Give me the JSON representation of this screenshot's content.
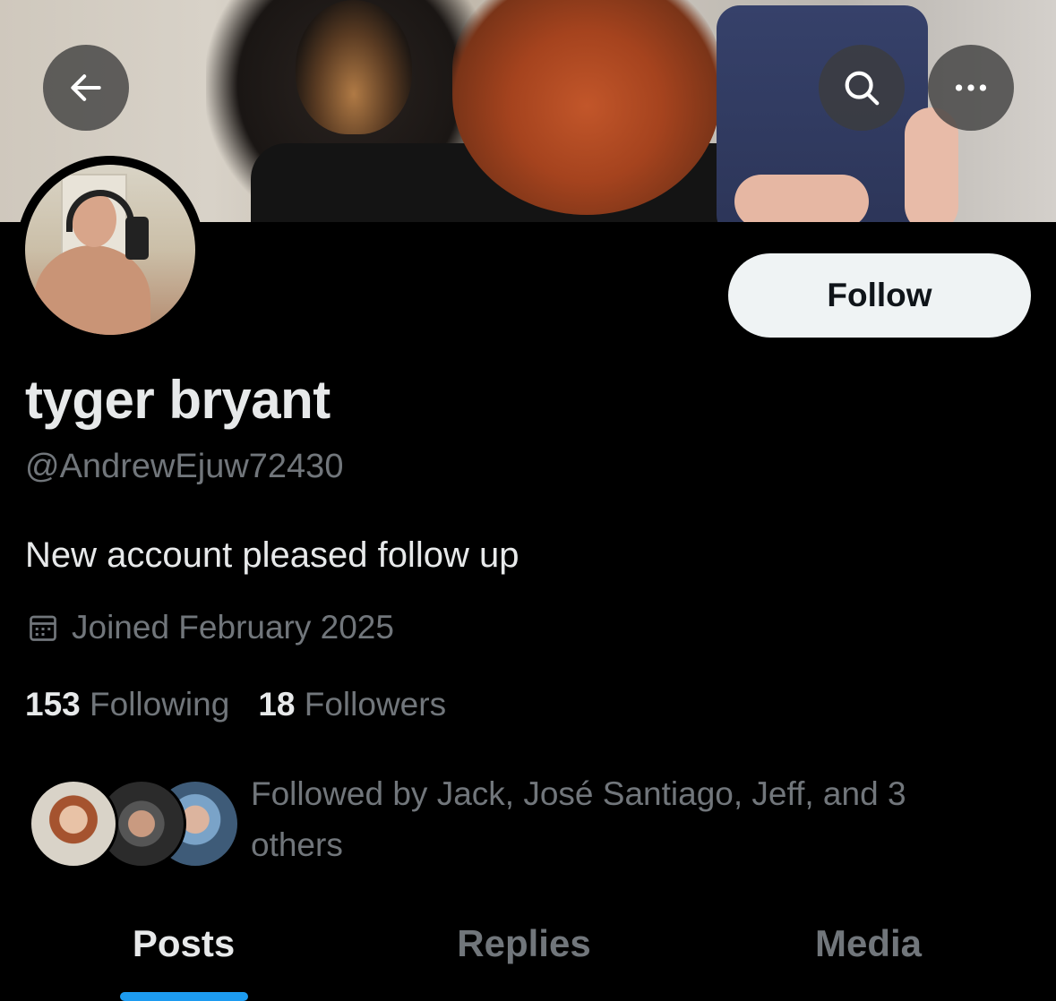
{
  "header": {
    "back_icon": "arrow-left-icon",
    "search_icon": "search-icon",
    "more_icon": "more-horizontal-icon"
  },
  "profile": {
    "display_name": "tyger bryant",
    "handle": "@AndrewEjuw72430",
    "bio": "New account pleased follow up",
    "joined_icon": "calendar-icon",
    "joined": "Joined February 2025",
    "follow_label": "Follow"
  },
  "stats": {
    "following_count": "153",
    "following_label": "Following",
    "followers_count": "18",
    "followers_label": "Followers"
  },
  "followed_by": {
    "text": "Followed by Jack, José Santiago, Jeff, and 3 others"
  },
  "tabs": [
    {
      "label": "Posts",
      "active": true
    },
    {
      "label": "Replies",
      "active": false
    },
    {
      "label": "Media",
      "active": false
    }
  ],
  "colors": {
    "background": "#000000",
    "primary_text": "#e7e9ea",
    "secondary_text": "#71767b",
    "accent": "#1d9bf0",
    "follow_button_bg": "#eff3f4"
  }
}
